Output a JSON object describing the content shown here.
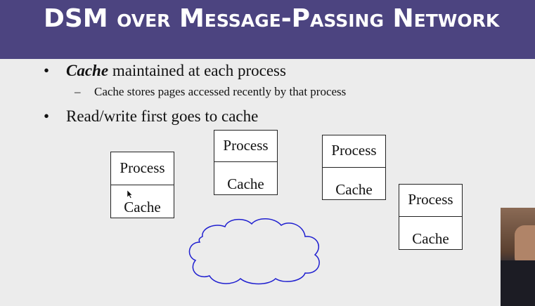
{
  "title": "DSM over Message-Passing Network",
  "bullets": [
    {
      "emph": "Cache",
      "rest": " maintained at each process"
    },
    {
      "text": "Read/write first goes to cache"
    }
  ],
  "sub_bullet": "Cache stores pages accessed recently by that process",
  "bullet_symbol": "•",
  "dash_symbol": "–",
  "boxes": [
    {
      "top": "Process",
      "bottom": "Cache"
    },
    {
      "top": "Process",
      "bottom": "Cache"
    },
    {
      "top": "Process",
      "bottom": "Cache"
    },
    {
      "top": "Process",
      "bottom": "Cache"
    }
  ],
  "colors": {
    "title_bg": "#4c4480",
    "cloud_stroke": "#1f1fd0"
  }
}
